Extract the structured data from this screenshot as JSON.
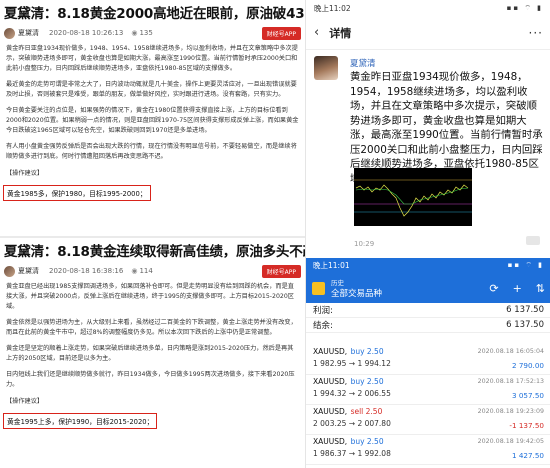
{
  "article1": {
    "title": "夏黛清：8.18黄金2000高地近在眼前，原油破43多！",
    "author": "夏黛清",
    "date": "2020-08-18 10:26:13",
    "views": "135",
    "app_label": "财经号APP",
    "paragraphs": [
      "黄金昨日亚盘1934现价做多，1948、1954、1958继续进场多，均以盈利收场，并且在文章策略中多次提示，突破顺势进场多即可，黄金收盘也算是如期大涨，最高涨至1990位置。当前行情暂时承压2000关口和此前小盘整压力，日内回踩后继续顺势进场多，亚盘依托1980-85区域的支撑做多。",
      "最近黄金的走势可谓是非常之大了，日内波动动辄就是几十美金，操作上更要灵活应对，一旦出现错误就要及时止损，否则被套只是难受，跟单的朋友，做单做好风控，实时跟进行进场。没有套路，只有实力。",
      "今日黄金要关注的点位是，如果强势的情况下，黄金在1980位置获得支撑直接上涨，上方的目标位看到2000和2020位置。如果稍弱一点的情况，则是亚盘回踩1970-75区间获得支撑形成反弹上涨，而如果黄金今日跌破这1965区域可以轻仓先空，如果跌破则回到1970还是多单进场。",
      "有人用小盘黄金强势反弹后是否会出现大跌的行情，现在行情没有明显信号前，不要轻易做空，而是继续将顺势做多进行到底。何时行情遭阻回落后再改变思路不迟。"
    ],
    "section_label": "【操作建议】",
    "advice": "黄金1985多，保护1980，目标1995-2000；"
  },
  "article2": {
    "title": "夏黛清：8.18黄金连续取得新高佳绩，原油多头不改！",
    "author": "夏黛清",
    "date": "2020-08-18 16:38:16",
    "views": "114",
    "app_label": "财经号APP",
    "paragraphs": [
      "黄金亚盘已经出现1985支撑回调进场多，如果回落补仓即可。但是走势明显没有给到回踩的机会，而是直接大涨，并且突破2000点，反弹上涨后在继续进场，终于1995的支撑做多即可。上方目标2015-2020区域。",
      "黄金依然是以强势进场为主，从大级别上来看，虽然经过二百美金的下跌调整，黄金上涨走势并没有改变，而且在此前的黄金牛市中，超过8%的调整幅度仍多见。所以本次回下跌后的上涨中仍是正常调整。",
      "黄金还是坚定的顺着上涨走势，如果突破后继续进场多单，日内策略是涨到2015-2020压力，然后是再其上方的2050区域，目前还是以多为主。",
      "日内短线上我们还是继续顺势做多就行，昨日1934做多，今日做多1995两次进场做多，接下来看2020压力。"
    ],
    "section_label": "【操作建议】",
    "advice": "黄金1995上多，保护1990，目标2015-2020；"
  },
  "phone_detail": {
    "status_time": "晚上11:02",
    "status_icons": "▪▪ ⌔ ▮",
    "back_icon": "‹",
    "title": "详情",
    "more_icon": "···",
    "author": "夏黛清",
    "text": "黄金昨日亚盘1934现价做多，1948，1954，1958继续进场多，均以盈利收场，并且在文章策略中多次提示，突破顺势进场多即可，黄金收盘也算是如期大涨，最高涨至1990位置。当前行情暂时承压2000关口和此前小盘整压力，日内回踩后继续顺势进场多，亚盘依托1980-85区域的支撑做多。",
    "time": "10:29"
  },
  "trading_app": {
    "status_time": "晚上11:01",
    "status_icons": "▪▪ ⌔ ▮",
    "small_title": "历史",
    "title": "全部交易品种",
    "toolbar_icons": [
      "⟳",
      "+",
      "⇅"
    ],
    "summary": [
      {
        "label": "利润:",
        "value": "6 137.50"
      },
      {
        "label": "结余:",
        "value": "6 137.50"
      }
    ],
    "orders": [
      {
        "symbol": "XAUUSD,",
        "dir": "buy 2.50",
        "side": "buy",
        "prices": "1 982.95 → 1 994.12",
        "time": "2020.08.18 16:05:04",
        "profit": "2 790.00",
        "profit_sign": "pos"
      },
      {
        "symbol": "XAUUSD,",
        "dir": "buy 2.50",
        "side": "buy",
        "prices": "1 994.32 → 2 006.55",
        "time": "2020.08.18 17:52:13",
        "profit": "3 057.50",
        "profit_sign": "pos"
      },
      {
        "symbol": "XAUUSD,",
        "dir": "sell 2.50",
        "side": "sell",
        "prices": "2 003.25 → 2 007.80",
        "time": "2020.08.18 19:23:09",
        "profit": "-1 137.50",
        "profit_sign": "neg"
      },
      {
        "symbol": "XAUUSD,",
        "dir": "buy 2.50",
        "side": "buy",
        "prices": "1 986.37 → 1 992.08",
        "time": "2020.08.18 19:42:05",
        "profit": "1 427.50",
        "profit_sign": "pos"
      }
    ]
  },
  "colors": {
    "accent_red": "#d8231a",
    "app_blue": "#1e6fd9",
    "author_blue": "#2d63b8"
  }
}
